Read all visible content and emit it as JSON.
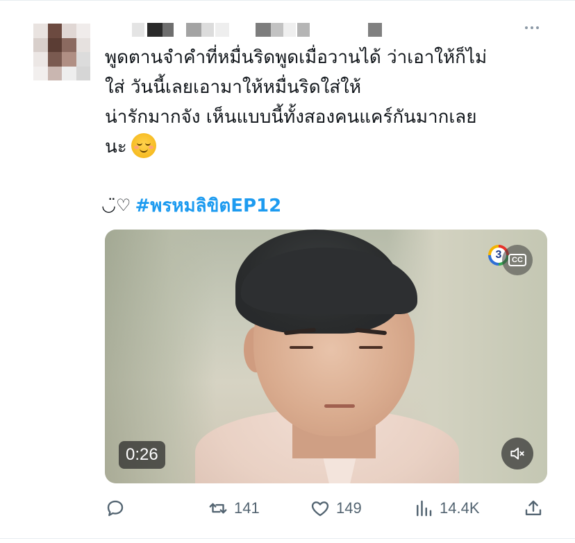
{
  "tweet": {
    "text_lines": [
      "พูดตานจำคำที่หมื่นริดพูดเมื่อวานได้ ว่าเอาให้ก็ไม่",
      "ใส่ วันนี้เลยเอามาให้หมื่นริดใส่ให้",
      "น่ารักมากจัง เห็นแบบนี้ทั้งสองคนแคร์กันมากเลย",
      "นะ"
    ],
    "emoji": "smiling-face-with-blush",
    "kaomoji": "◡̈♡",
    "hashtag": "#พรหมลิขิตEP12"
  },
  "video": {
    "channel_logo_text": "3",
    "cc_label": "CC",
    "duration": "0:26"
  },
  "actions": {
    "reply_count": "",
    "retweet_count": "141",
    "like_count": "149",
    "views_count": "14.4K"
  },
  "colors": {
    "accent": "#1d9bf0",
    "text": "#0f1419",
    "muted": "#536471"
  }
}
